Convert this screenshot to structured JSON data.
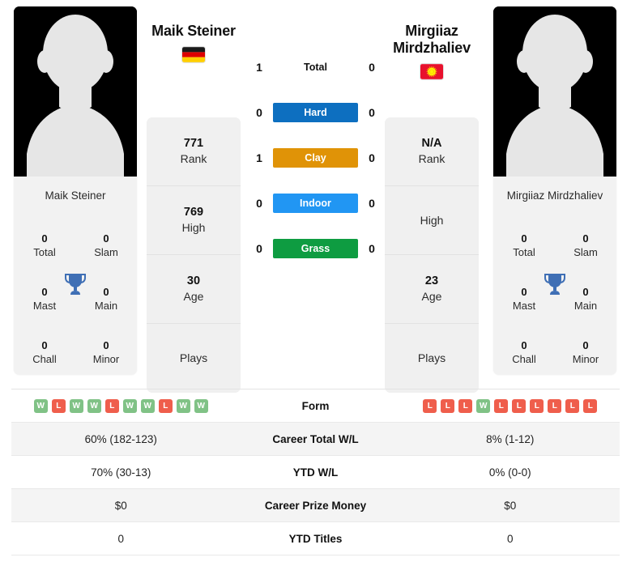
{
  "players": {
    "left": {
      "name": "Maik Steiner",
      "photo_caption": "Maik Steiner",
      "flag": "de",
      "flag_name": "germany-flag",
      "rank": "771",
      "rank_label": "Rank",
      "high": "769",
      "high_label": "High",
      "age": "30",
      "age_label": "Age",
      "plays": "",
      "plays_label": "Plays",
      "titles": {
        "total": "0",
        "total_label": "Total",
        "slam": "0",
        "slam_label": "Slam",
        "mast": "0",
        "mast_label": "Mast",
        "main": "0",
        "main_label": "Main",
        "chall": "0",
        "chall_label": "Chall",
        "minor": "0",
        "minor_label": "Minor"
      }
    },
    "right": {
      "name": "Mirgiiaz Mirdzhaliev",
      "photo_caption": "Mirgiiaz Mirdzhaliev",
      "flag": "kg",
      "flag_name": "kyrgyzstan-flag",
      "rank": "N/A",
      "rank_label": "Rank",
      "high": "",
      "high_label": "High",
      "age": "23",
      "age_label": "Age",
      "plays": "",
      "plays_label": "Plays",
      "titles": {
        "total": "0",
        "total_label": "Total",
        "slam": "0",
        "slam_label": "Slam",
        "mast": "0",
        "mast_label": "Mast",
        "main": "0",
        "main_label": "Main",
        "chall": "0",
        "chall_label": "Chall",
        "minor": "0",
        "minor_label": "Minor"
      }
    }
  },
  "head_to_head": [
    {
      "label": "Total",
      "left": "1",
      "right": "0",
      "color": "",
      "plain": true
    },
    {
      "label": "Hard",
      "left": "0",
      "right": "0",
      "color": "#0d6fc0",
      "plain": false
    },
    {
      "label": "Clay",
      "left": "1",
      "right": "0",
      "color": "#e09307",
      "plain": false
    },
    {
      "label": "Indoor",
      "left": "0",
      "right": "0",
      "color": "#2196f3",
      "plain": false
    },
    {
      "label": "Grass",
      "left": "0",
      "right": "0",
      "color": "#0e9c41",
      "plain": false
    }
  ],
  "stats_table": {
    "form": {
      "label": "Form",
      "left": [
        "W",
        "L",
        "W",
        "W",
        "L",
        "W",
        "W",
        "L",
        "W",
        "W"
      ],
      "right": [
        "L",
        "L",
        "L",
        "W",
        "L",
        "L",
        "L",
        "L",
        "L",
        "L"
      ]
    },
    "rows": [
      {
        "label": "Career Total W/L",
        "left": "60% (182-123)",
        "right": "8% (1-12)",
        "shaded": true
      },
      {
        "label": "YTD W/L",
        "left": "70% (30-13)",
        "right": "0% (0-0)",
        "shaded": false
      },
      {
        "label": "Career Prize Money",
        "left": "$0",
        "right": "$0",
        "shaded": true
      },
      {
        "label": "YTD Titles",
        "left": "0",
        "right": "0",
        "shaded": false
      }
    ]
  },
  "colors": {
    "hard": "#0d6fc0",
    "clay": "#e09307",
    "indoor": "#2196f3",
    "grass": "#0e9c41",
    "win_badge": "#80c286",
    "loss_badge": "#ef5e4c",
    "trophy": "#3f6fb5"
  }
}
